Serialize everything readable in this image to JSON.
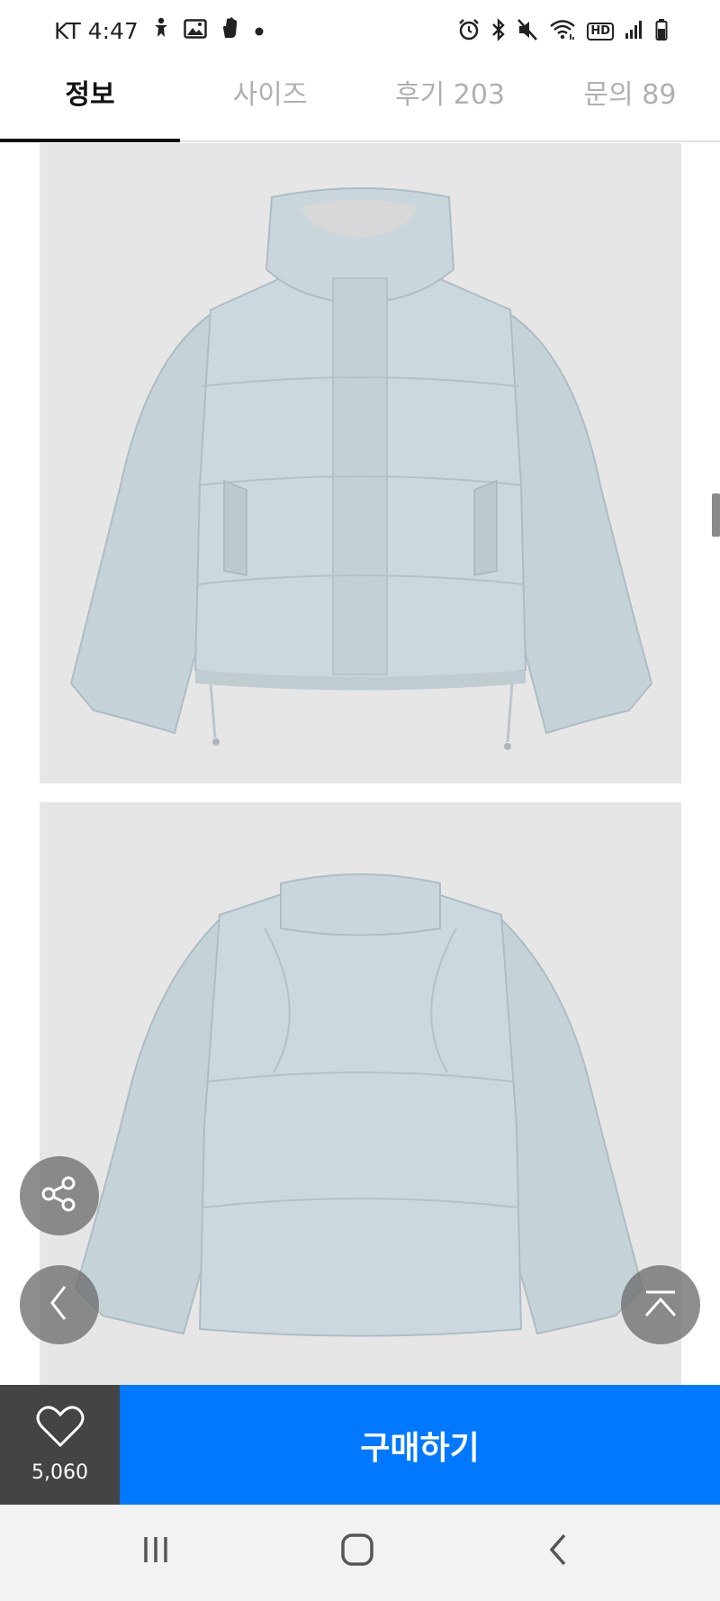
{
  "status_bar": {
    "carrier_time": "KT 4:47",
    "left_icons": [
      "accessibility-icon",
      "gallery-icon",
      "hand-icon",
      "dot-icon"
    ],
    "right_icons": [
      "alarm-icon",
      "bluetooth-icon",
      "mute-icon",
      "wifi-icon",
      "hd-icon",
      "signal-icon",
      "battery-icon"
    ],
    "hd_label": "HD"
  },
  "tabs": [
    {
      "label": "정보",
      "active": true
    },
    {
      "label": "사이즈",
      "active": false
    },
    {
      "label": "후기 203",
      "active": false
    },
    {
      "label": "문의 89",
      "active": false
    }
  ],
  "images": [
    {
      "name": "front-view",
      "subject": "light blue puffer jacket front"
    },
    {
      "name": "back-view",
      "subject": "light blue puffer jacket back"
    }
  ],
  "floating_buttons": {
    "share": "share-icon",
    "prev": "chevron-left-icon",
    "top": "scroll-top-icon"
  },
  "purchase_bar": {
    "like_count": "5,060",
    "buy_label": "구매하기"
  },
  "colors": {
    "accent": "#0078ff",
    "like_bg": "#444444",
    "jacket": "#c5d3d9"
  },
  "nav_bar": [
    "recent-apps-icon",
    "home-icon",
    "back-icon"
  ]
}
